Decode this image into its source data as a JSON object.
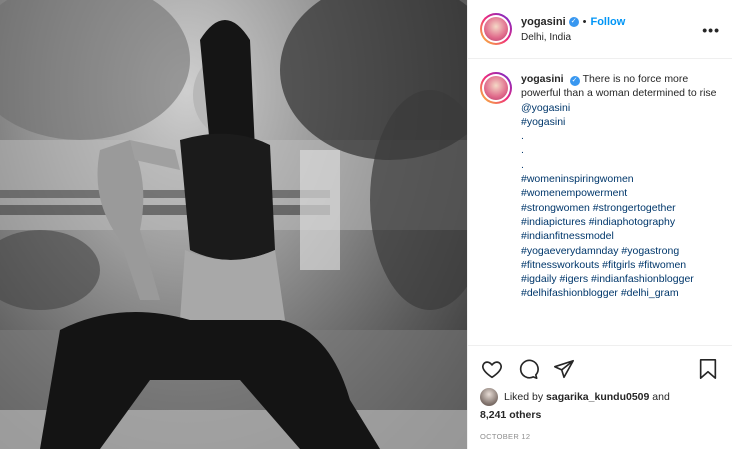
{
  "post": {
    "username": "yogasini",
    "follow_label": "Follow",
    "dot": "•",
    "location": "Delhi, India",
    "more_label": "•••"
  },
  "caption": {
    "username": "yogasini",
    "text": "There is no force more powerful than a woman determined to rise",
    "lines": [
      "@yogasini",
      "#yogasini",
      ".",
      ".",
      ".",
      "#womeninspiringwomen",
      "#womenempowerment",
      "#strongwomen #strongertogether",
      "#indiapictures #indiaphotography",
      "#indianfitnessmodel",
      "#yogaeverydamnday #yogastrong",
      "#fitnessworkouts #fitgirls #fitwomen",
      "#igdaily #igers #indianfashionblogger",
      "#delhifashionblogger #delhi_gram"
    ]
  },
  "icons": [
    "heart-icon",
    "comment-icon",
    "share-icon",
    "bookmark-icon",
    "verified-icon",
    "more-icon"
  ],
  "likes": {
    "prefix": "Liked by",
    "user": "sagarika_kundu0509",
    "and": "and",
    "others": "8,241 others"
  },
  "date": "OCTOBER 12",
  "colors": {
    "link": "#00376b",
    "follow": "#0095f6",
    "verified": "#3897f0"
  }
}
